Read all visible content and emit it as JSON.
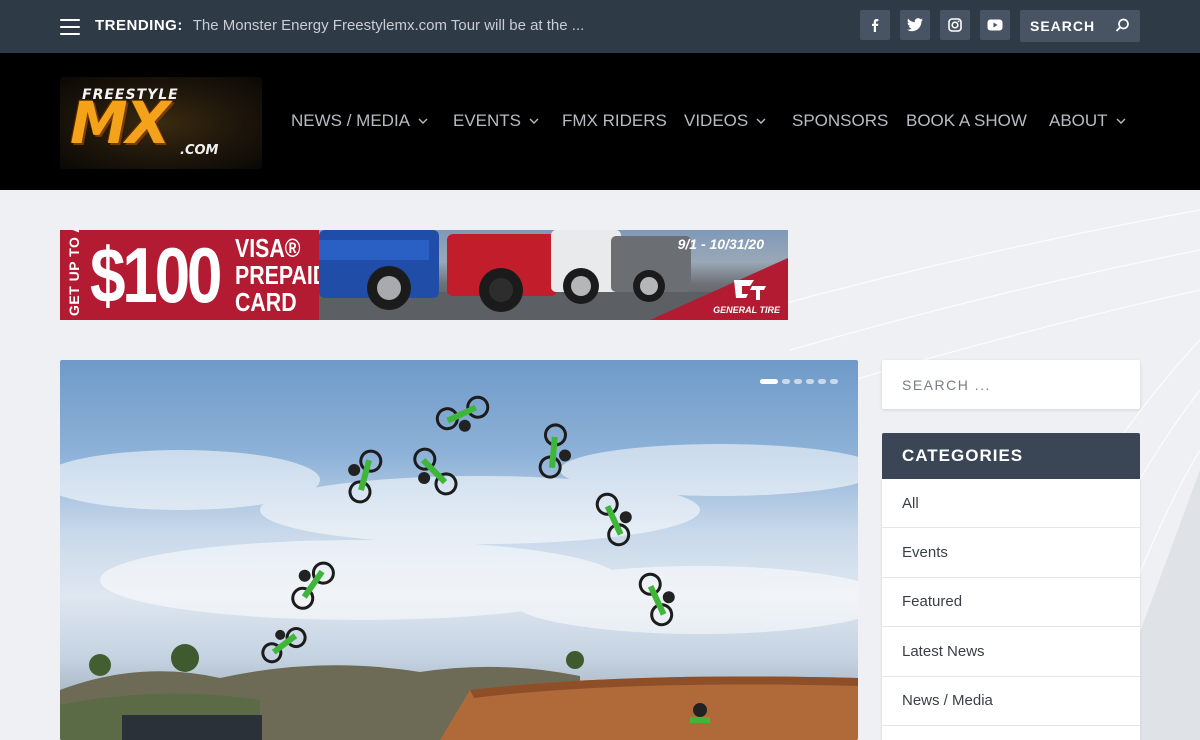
{
  "topbar": {
    "trending_label": "TRENDING:",
    "trending_text": "The Monster Energy Freestylemx.com Tour will be at the ...",
    "social": [
      {
        "icon": "facebook-icon",
        "glyph": "f"
      },
      {
        "icon": "twitter-icon",
        "glyph": ""
      },
      {
        "icon": "instagram-icon",
        "glyph": ""
      },
      {
        "icon": "youtube-icon",
        "glyph": ""
      }
    ],
    "search_placeholder": "SEARCH"
  },
  "header": {
    "logo": {
      "top": "FREESTYLE",
      "main": "MX",
      "domain": ".COM"
    },
    "nav": [
      {
        "label": "NEWS / MEDIA",
        "dropdown": true
      },
      {
        "label": "EVENTS",
        "dropdown": true
      },
      {
        "label": "FMX RIDERS",
        "dropdown": false
      },
      {
        "label": "VIDEOS",
        "dropdown": true
      },
      {
        "label": "SPONSORS",
        "dropdown": false
      },
      {
        "label": "BOOK A SHOW",
        "dropdown": false
      },
      {
        "label": "ABOUT",
        "dropdown": true
      }
    ]
  },
  "ad": {
    "side_text": "GET UP TO A",
    "amount": "$100",
    "line1": "VISA®",
    "line2": "PREPAID",
    "line3": "CARD",
    "dates": "9/1 - 10/31/20",
    "brand": "GENERAL TIRE"
  },
  "slider": {
    "slide_count": 6,
    "active_index": 0
  },
  "sidebar": {
    "search_placeholder": "SEARCH ...",
    "categories_title": "CATEGORIES",
    "categories": [
      "All",
      "Events",
      "Featured",
      "Latest News",
      "News / Media",
      ""
    ]
  },
  "colors": {
    "topbar_bg": "#2f3a47",
    "header_bg": "#000000",
    "nav_text": "#b8bcc2",
    "accent_red": "#b21b32",
    "sidebar_head": "#3a4656",
    "logo_orange": "#f3a21a"
  }
}
